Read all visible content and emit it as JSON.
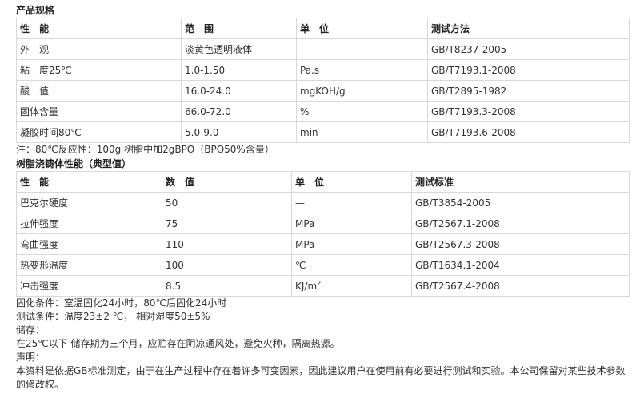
{
  "section1": {
    "title": "产品规格",
    "headers": [
      "性　能",
      "范　围",
      "单　位",
      "测试方法"
    ],
    "rows": [
      [
        "外　观",
        "淡黄色透明液体",
        "-",
        "GB/T8237-2005"
      ],
      [
        "粘　度25℃",
        "1.0-1.50",
        "Pa.s",
        "GB/T7193.1-2008"
      ],
      [
        "酸　值",
        "16.0-24.0",
        "mgKOH/g",
        "GB/T2895-1982"
      ],
      [
        "固体含量",
        "66.0-72.0",
        "%",
        "GB/T7193.3-2008"
      ],
      [
        "凝胶时间80℃",
        "5.0-9.0",
        "min",
        "GB/T7193.6-2008"
      ]
    ],
    "note": "注：80℃反应性：100g 树脂中加2gBPO（BPO50%含量）"
  },
  "section2": {
    "title": "树脂浇铸体性能（典型值）",
    "headers": [
      "性　能",
      "数　值",
      "单　位",
      "测试标准"
    ],
    "rows": [
      [
        "巴克尔硬度",
        "50",
        "—",
        "GB/T3854-2005"
      ],
      [
        "拉伸强度",
        "75",
        "MPa",
        "GB/T2567.1-2008"
      ],
      [
        "弯曲强度",
        "110",
        "MPa",
        "GB/T2567.3-2008"
      ],
      [
        "热变形温度",
        "100",
        "℃",
        "GB/T1634.1-2004"
      ],
      [
        "冲击强度",
        "8.5",
        "KJ/m",
        "GB/T2567.4-2008"
      ]
    ],
    "impact_unit_superscript": "2"
  },
  "footer": {
    "cure": "固化条件：室温固化24小时，80℃后固化24小时",
    "test": "测试条件：温度23±2 ℃， 相对湿度50±5%",
    "storage_label": "储存：",
    "storage_text": "在25℃以下 储存期为三个月，应贮存在阴凉通风处，避免火种，隔离热源。",
    "statement_label": "声明：",
    "statement_text": "本资料是依据GB标准测定，由于在生产过程中存在着许多可变因素，因此建议用户在使用前有必要进行测试和实验。本公司保留对某些技术参数的修改权。"
  }
}
